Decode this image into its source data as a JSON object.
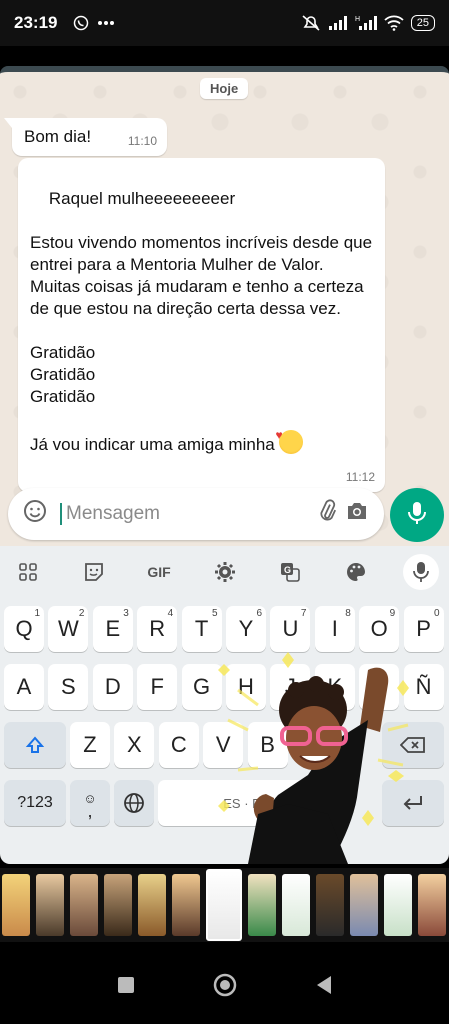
{
  "status_bar": {
    "time": "23:19",
    "battery": "25",
    "notif_icons": [
      "whatsapp-icon",
      "more-dots-icon"
    ],
    "sys_icons": [
      "mute-icon",
      "signal-icon",
      "signal-h-icon",
      "wifi-icon",
      "battery-icon"
    ]
  },
  "chat": {
    "date_chip": "Hoje",
    "messages": [
      {
        "text": "Bom dia!",
        "time": "11:10"
      },
      {
        "text": "Raquel mulheeeeeeeeer\n\nEstou vivendo momentos incríveis desde que entrei para a Mentoria Mulher de Valor. Muitas coisas já mudaram e tenho a certeza de que estou na direção certa dessa vez.\n\nGratidão\nGratidão\nGratidão\n\nJá vou indicar uma amiga minha",
        "time": "11:12"
      }
    ]
  },
  "input": {
    "placeholder": "Mensagem"
  },
  "keyboard": {
    "toolbar": {
      "gif_label": "GIF"
    },
    "row1": [
      {
        "k": "Q",
        "s": "1"
      },
      {
        "k": "W",
        "s": "2"
      },
      {
        "k": "E",
        "s": "3"
      },
      {
        "k": "R",
        "s": "4"
      },
      {
        "k": "T",
        "s": "5"
      },
      {
        "k": "Y",
        "s": "6"
      },
      {
        "k": "U",
        "s": "7"
      },
      {
        "k": "I",
        "s": "8"
      },
      {
        "k": "O",
        "s": "9"
      },
      {
        "k": "P",
        "s": "0"
      }
    ],
    "row2": [
      "A",
      "S",
      "D",
      "F",
      "G",
      "H",
      "J",
      "K",
      "L",
      "Ñ"
    ],
    "row3": [
      "Z",
      "X",
      "C",
      "V",
      "B"
    ],
    "numbers_label": "?123",
    "comma": ",",
    "space_label": "ES · PT"
  },
  "colors": {
    "accent": "#00a884",
    "chat_bg": "#efe7de",
    "keyboard_bg": "#eceff1"
  }
}
